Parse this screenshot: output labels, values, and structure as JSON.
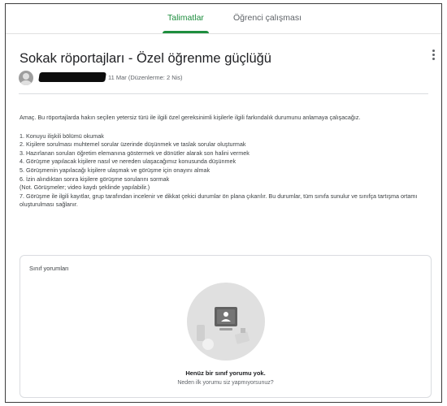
{
  "tabs": [
    {
      "label": "Talimatlar",
      "active": true
    },
    {
      "label": "Öğrenci çalışması",
      "active": false
    }
  ],
  "assignment": {
    "title": "Sokak röportajları - Özel öğrenme güçlüğü",
    "date": "11 Mar (Düzenlerme: 2 Nis)",
    "intro": "Amaç. Bu röportajlarda hakın seçilen yetersiz türü ile ilgili özel gereksinimli kişilerle ilgili farkındalık durumunu anlamaya çalışacağız.",
    "steps": [
      "1. Konuyu ilişkili bölümü okumak",
      "2. Kişilere sorulması muhtemel sorular üzerinde düşünmek ve taslak sorular oluşturmak",
      "3. Hazırlanan soruları öğretim elemanına göstermek ve dönütler alarak son halini vermek",
      "4. Görüşme yapılacak kişilere nasıl ve nereden ulaşacağımız konusunda düşünmek",
      "5. Görüşmenin yapılacağı kişilere ulaşmak ve görüşme için onayını almak",
      "6. İzin alındıktan sonra kişilere görüşme sorularını sormak",
      "(Not. Görüşmeler; video kaydı şeklinde yapılabilir.)",
      "7. Görüşme ile ilgili kayıtlar, grup tarafından incelenir ve dikkat çekici durumlar ön plana çıkarılır. Bu durumlar, tüm sınıfa sunulur ve sınıfça tartışma ortamı oluşturulması sağlanır."
    ]
  },
  "comments": {
    "title": "Sınıf yorumları",
    "empty_title": "Henüz bir sınıf yorumu yok.",
    "empty_subtitle": "Neden ilk yorumu siz yapmıyorsunuz?"
  },
  "colors": {
    "accent": "#1e8e3e",
    "illustration_bg": "#e0e0e0"
  },
  "icons": {
    "menu": "more-vert-icon",
    "avatar": "person-icon"
  }
}
